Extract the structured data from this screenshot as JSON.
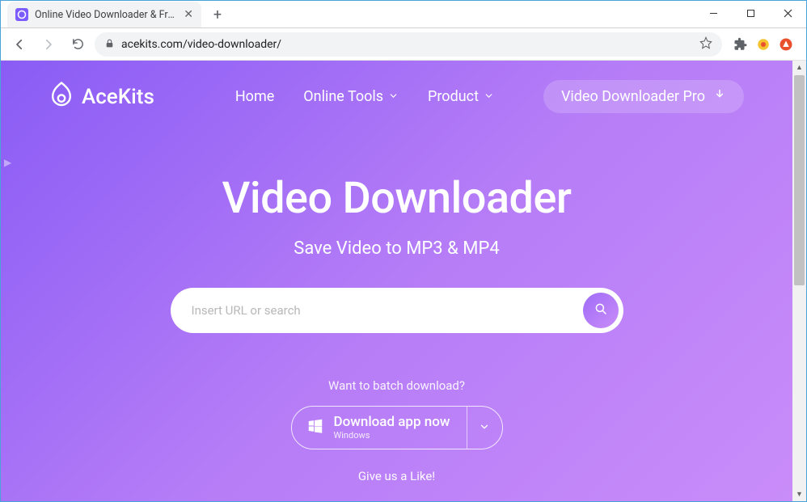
{
  "browser": {
    "tab_title": "Online Video Downloader & Free",
    "url": "acekits.com/video-downloader/"
  },
  "header": {
    "logo_text": "AceKits",
    "nav": {
      "home": "Home",
      "online_tools": "Online Tools",
      "product": "Product"
    },
    "cta": "Video Downloader Pro"
  },
  "hero": {
    "title": "Video Downloader",
    "subtitle": "Save Video to MP3 & MP4",
    "search_placeholder": "Insert URL or search",
    "batch_link": "Want to batch download?",
    "download_label": "Download app now",
    "download_platform": "Windows",
    "like_link": "Give us a Like!"
  }
}
